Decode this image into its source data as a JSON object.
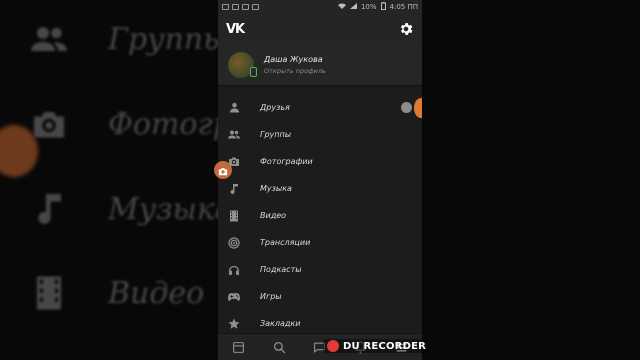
{
  "background": {
    "items": [
      {
        "label": "Группы",
        "icon": "groups-icon"
      },
      {
        "label": "Фотографи",
        "icon": "camera-icon"
      },
      {
        "label": "Музыка",
        "icon": "music-icon"
      },
      {
        "label": "Видео",
        "icon": "video-icon"
      }
    ]
  },
  "statusbar": {
    "battery": "10%",
    "time": "4:05 ПП"
  },
  "appbar": {
    "logo": "VK",
    "settings_icon": "gear-icon"
  },
  "profile": {
    "name": "Даша Жукова",
    "subtitle": "Открыть профиль"
  },
  "menu": {
    "items": [
      {
        "label": "Друзья",
        "icon": "person-icon"
      },
      {
        "label": "Группы",
        "icon": "groups-icon"
      },
      {
        "label": "Фотографии",
        "icon": "camera-icon"
      },
      {
        "label": "Музыка",
        "icon": "music-icon"
      },
      {
        "label": "Видео",
        "icon": "video-icon"
      },
      {
        "label": "Трансляции",
        "icon": "broadcast-icon"
      },
      {
        "label": "Подкасты",
        "icon": "headphones-icon"
      },
      {
        "label": "Игры",
        "icon": "gamepad-icon"
      },
      {
        "label": "Закладки",
        "icon": "star-icon"
      }
    ]
  },
  "bottombar": {
    "icons": [
      "news-icon",
      "search-icon",
      "messages-icon",
      "notifications-icon",
      "menu-icon"
    ]
  },
  "overlay": {
    "recorder_label": "DU RECORDER"
  },
  "colors": {
    "accent_orange": "#e07a2e",
    "online_green": "#4caf50",
    "panel": "#1c1c1c",
    "bar": "#252525"
  }
}
